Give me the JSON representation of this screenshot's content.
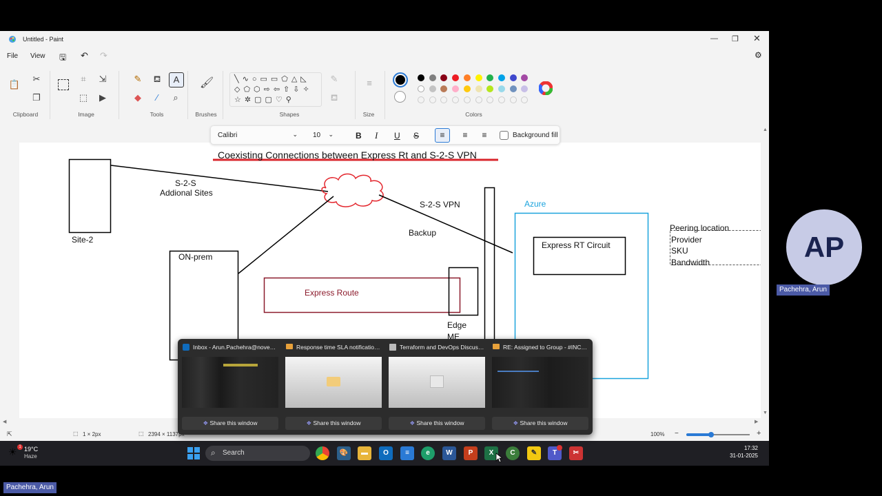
{
  "window": {
    "title": "Untitled - Paint"
  },
  "menu": {
    "file": "File",
    "view": "View"
  },
  "ribbon": {
    "groups": {
      "clipboard": "Clipboard",
      "image": "Image",
      "tools": "Tools",
      "brushes": "Brushes",
      "shapes": "Shapes",
      "size": "Size",
      "colors": "Colors"
    },
    "colors_row1": [
      "#000000",
      "#7f7f7f",
      "#880015",
      "#ed1c24",
      "#ff7f27",
      "#fff200",
      "#22b14c",
      "#00a2e8",
      "#3f48cc",
      "#a349a4"
    ],
    "colors_row2": [
      "#ffffff",
      "#c3c3c3",
      "#b97a57",
      "#ffaec9",
      "#ffc90e",
      "#efe4b0",
      "#b5e61d",
      "#99d9ea",
      "#7092be",
      "#c8bfe7"
    ]
  },
  "format_bar": {
    "font": "Calibri",
    "size": "10",
    "bold": "B",
    "italic": "I",
    "underline": "U",
    "strike": "S",
    "background_fill": "Background fill"
  },
  "diagram": {
    "title": "Coexisting Connections between Express Rt and S-2-S VPN",
    "site2": "Site-2",
    "s2s_line1": "S-2-S",
    "s2s_line2": "Addional Sites",
    "s2s_vpn": "S-2-S VPN",
    "backup": "Backup",
    "onprem": "ON-prem",
    "express_route": "Express Route",
    "edge_line1": "Edge",
    "edge_line2": "ME",
    "azure": "Azure",
    "express_rt_circuit": "Express RT Circuit",
    "notes": [
      "Peering location",
      "Provider",
      "SKU",
      "Bandwidth"
    ]
  },
  "status": {
    "selection": "1 × 2px",
    "canvas_size": "2394 × 1137px",
    "zoom": "100%"
  },
  "taskbar": {
    "weather_temp": "19°C",
    "weather_desc": "Haze",
    "search_placeholder": "Search",
    "time": "17:32",
    "date": "31-01-2025"
  },
  "popup": {
    "windows": [
      {
        "title": "Inbox - Arun.Pachehra@novent...",
        "share": "Share this window"
      },
      {
        "title": "Response time SLA notification ...",
        "share": "Share this window"
      },
      {
        "title": "Terraform and DevOps Discussi...",
        "share": "Share this window"
      },
      {
        "title": "RE: Assigned to Group - #INC-6...",
        "share": "Share this window"
      }
    ]
  },
  "participant": {
    "initials": "AP",
    "name": "Pachehra, Arun"
  }
}
